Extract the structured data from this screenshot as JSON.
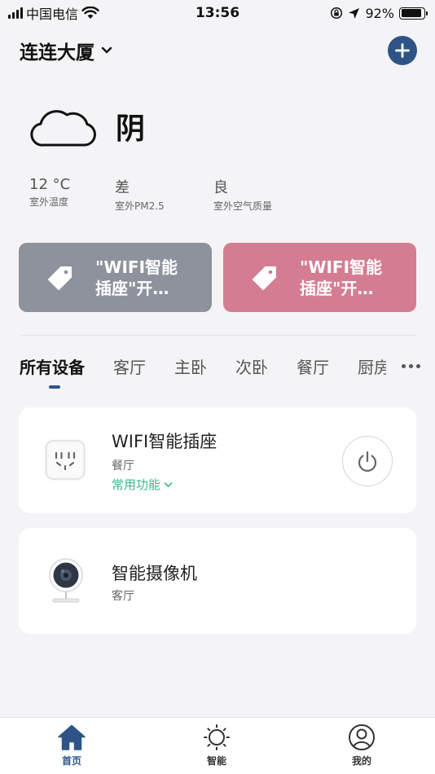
{
  "status_bar": {
    "carrier": "中国电信",
    "time": "13:56",
    "battery": "92%",
    "battery_level": 0.92
  },
  "header": {
    "home_name": "连连大厦",
    "home_dropdown_icon": "chevron-down-icon",
    "add_icon": "plus-icon"
  },
  "weather": {
    "icon": "cloud-icon",
    "condition": "阴",
    "metrics": [
      {
        "value": "12 °C",
        "label": "室外温度"
      },
      {
        "value": "差",
        "label": "室外PM2.5"
      },
      {
        "value": "良",
        "label": "室外空气质量"
      }
    ]
  },
  "scenes": [
    {
      "label": "\"WIFI智能插座\"开…",
      "icon": "tag-icon",
      "color": "#8d929c"
    },
    {
      "label": "\"WIFI智能插座\"开…",
      "icon": "tag-icon",
      "color": "#d47d92"
    }
  ],
  "room_tabs": {
    "items": [
      "所有设备",
      "客厅",
      "主卧",
      "次卧",
      "餐厅",
      "厨房"
    ],
    "active_index": 0,
    "more_icon": "more-icon"
  },
  "devices": [
    {
      "name": "WIFI智能插座",
      "room": "餐厅",
      "function_label": "常用功能",
      "icon": "socket-icon",
      "power_icon": "power-icon"
    },
    {
      "name": "智能摄像机",
      "room": "客厅",
      "icon": "camera-icon"
    }
  ],
  "tab_bar": {
    "items": [
      {
        "label": "首页",
        "icon": "home-icon"
      },
      {
        "label": "智能",
        "icon": "sun-icon"
      },
      {
        "label": "我的",
        "icon": "user-icon"
      }
    ],
    "active_index": 0
  },
  "colors": {
    "accent": "#2e5487",
    "function_green": "#3bb88a",
    "background": "#f4f4f6"
  }
}
